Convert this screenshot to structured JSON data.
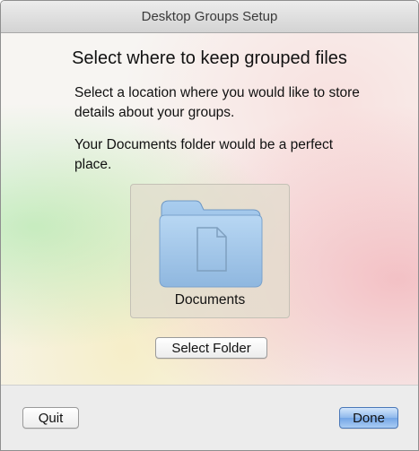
{
  "window": {
    "title": "Desktop Groups Setup"
  },
  "main": {
    "heading": "Select where to keep grouped files",
    "paragraph1": "Select a location where you would like to store details about your groups.",
    "paragraph2": "Your Documents folder would be a perfect place.",
    "folder": {
      "icon": "folder-icon",
      "label": "Documents"
    },
    "select_folder_label": "Select Folder"
  },
  "footer": {
    "quit_label": "Quit",
    "done_label": "Done"
  },
  "colors": {
    "default_button": "#74a6e6",
    "folder_blue": "#9cc3e6"
  }
}
